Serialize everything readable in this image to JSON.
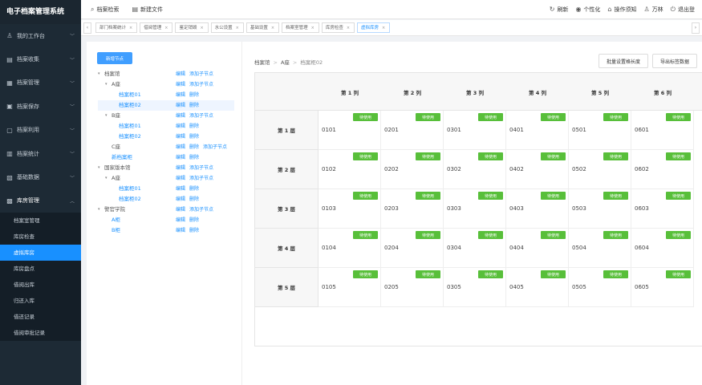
{
  "app": {
    "title": "电子档案管理系统"
  },
  "sidebar": {
    "items": [
      {
        "label": "我的工作台",
        "icon": "user-icon"
      },
      {
        "label": "档案收集",
        "icon": "folder-icon"
      },
      {
        "label": "档案管理",
        "icon": "archive-icon"
      },
      {
        "label": "档案保存",
        "icon": "save-icon"
      },
      {
        "label": "档案利用",
        "icon": "file-icon"
      },
      {
        "label": "档案统计",
        "icon": "chart-icon"
      },
      {
        "label": "基础数据",
        "icon": "database-icon"
      },
      {
        "label": "库房管理",
        "icon": "warehouse-icon"
      }
    ],
    "sub_items": [
      "档案室管理",
      "库房检查",
      "虚拟库房",
      "库房盘点",
      "借阅出库",
      "归还入库",
      "借还记录",
      "借阅审批记录"
    ],
    "active_sub": "虚拟库房"
  },
  "topbar": {
    "left": [
      {
        "label": "档案检索",
        "icon": "search-icon"
      },
      {
        "label": "新建文件",
        "icon": "new-file-icon"
      }
    ],
    "right": [
      {
        "label": "刷新",
        "icon": "refresh-icon"
      },
      {
        "label": "个性化",
        "icon": "eye-icon"
      },
      {
        "label": "操作须知",
        "icon": "home-icon"
      },
      {
        "label": "万林",
        "icon": "user-icon"
      },
      {
        "label": "退出登",
        "icon": "logout-icon"
      }
    ]
  },
  "tags": [
    {
      "label": "部门档案统计",
      "active": false
    },
    {
      "label": "借阅管理",
      "active": false
    },
    {
      "label": "鉴定销毁",
      "active": false
    },
    {
      "label": "水公设置",
      "active": false
    },
    {
      "label": "基础设置",
      "active": false
    },
    {
      "label": "档案室管理",
      "active": false
    },
    {
      "label": "库房检查",
      "active": false
    },
    {
      "label": "虚拟库房",
      "active": true
    }
  ],
  "tree": {
    "new_node_label": "新增节点",
    "nodes": [
      {
        "label": "档案馆",
        "caret": "▾",
        "leaf": false,
        "actions": [
          "编辑",
          "添加子节点"
        ]
      },
      {
        "label": "A座",
        "caret": "▾",
        "leaf": false,
        "actions": [
          "编辑",
          "添加子节点"
        ]
      },
      {
        "label": "档案柜01",
        "caret": "",
        "leaf": true,
        "actions": [
          "编辑",
          "删除"
        ]
      },
      {
        "label": "档案柜02",
        "caret": "",
        "leaf": true,
        "actions": [
          "编辑",
          "删除"
        ],
        "selected": true
      },
      {
        "label": "B座",
        "caret": "▾",
        "leaf": false,
        "actions": [
          "编辑",
          "添加子节点"
        ]
      },
      {
        "label": "档案柜01",
        "caret": "",
        "leaf": true,
        "actions": [
          "编辑",
          "删除"
        ]
      },
      {
        "label": "档案柜02",
        "caret": "",
        "leaf": true,
        "actions": [
          "编辑",
          "删除"
        ]
      },
      {
        "label": "C座",
        "caret": "",
        "leaf": false,
        "actions": [
          "编辑",
          "删除",
          "添加子节点"
        ]
      },
      {
        "label": "新档案柜",
        "caret": "",
        "leaf": true,
        "actions": [
          "编辑",
          "删除"
        ]
      },
      {
        "label": "国家版本馆",
        "caret": "▾",
        "leaf": false,
        "actions": [
          "编辑",
          "添加子节点"
        ]
      },
      {
        "label": "A座",
        "caret": "▾",
        "leaf": false,
        "actions": [
          "编辑",
          "添加子节点"
        ]
      },
      {
        "label": "档案柜01",
        "caret": "",
        "leaf": true,
        "actions": [
          "编辑",
          "删除"
        ]
      },
      {
        "label": "档案柜02",
        "caret": "",
        "leaf": true,
        "actions": [
          "编辑",
          "删除"
        ]
      },
      {
        "label": "警官学院",
        "caret": "▾",
        "leaf": false,
        "actions": [
          "编辑",
          "添加子节点"
        ]
      },
      {
        "label": "A柜",
        "caret": "",
        "leaf": true,
        "actions": [
          "编辑",
          "删除"
        ]
      },
      {
        "label": "B柜",
        "caret": "",
        "leaf": true,
        "actions": [
          "编辑",
          "删除"
        ]
      }
    ]
  },
  "content": {
    "breadcrumb": [
      "档案馆",
      "A座",
      "档案柜02"
    ],
    "buttons": [
      "批量设置格长度",
      "导出标签数据"
    ],
    "columns": [
      "第 1 列",
      "第 2 列",
      "第 3 列",
      "第 4 列",
      "第 5 列",
      "第 6 列"
    ],
    "rows": [
      "第 1 层",
      "第 2 层",
      "第 3 层",
      "第 4 层",
      "第 5 层"
    ],
    "status_label": "待使用",
    "cell_codes": [
      [
        "0101",
        "0201",
        "0301",
        "0401",
        "0501",
        "0601"
      ],
      [
        "0102",
        "0202",
        "0302",
        "0402",
        "0502",
        "0602"
      ],
      [
        "0103",
        "0203",
        "0303",
        "0403",
        "0503",
        "0603"
      ],
      [
        "0104",
        "0204",
        "0304",
        "0404",
        "0504",
        "0604"
      ],
      [
        "0105",
        "0205",
        "0305",
        "0405",
        "0505",
        "0605"
      ]
    ],
    "status_color": "#58bf3a"
  },
  "colors": {
    "sidebar_bg": "#1d2a35",
    "accent": "#1890ff",
    "status": "#58bf3a"
  }
}
